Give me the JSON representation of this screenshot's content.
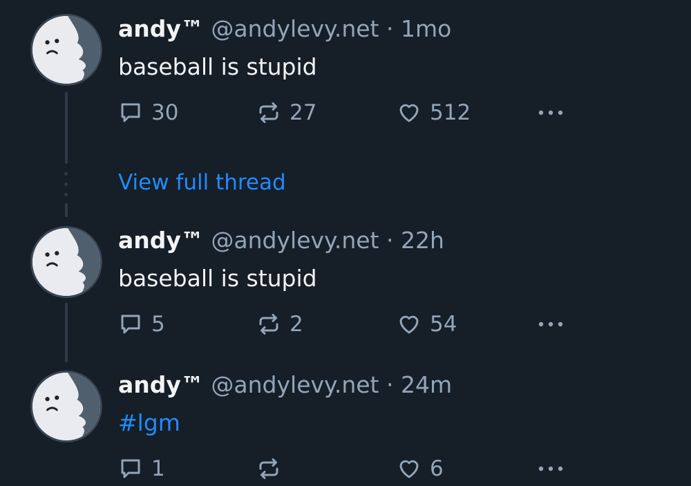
{
  "posts": [
    {
      "display_name": "andy™",
      "handle": "@andylevy.net",
      "separator": "·",
      "time": "1mo",
      "text": "baseball is stupid",
      "replies": "30",
      "reposts": "27",
      "likes": "512"
    },
    {
      "display_name": "andy™",
      "handle": "@andylevy.net",
      "separator": "·",
      "time": "22h",
      "text": "baseball is stupid",
      "replies": "5",
      "reposts": "2",
      "likes": "54"
    },
    {
      "display_name": "andy™",
      "handle": "@andylevy.net",
      "separator": "·",
      "time": "24m",
      "text": "#lgm",
      "replies": "1",
      "reposts": "",
      "likes": "6"
    }
  ],
  "view_full_thread": "View full thread",
  "colors": {
    "background": "#161e27",
    "text_primary": "#f1f3f5",
    "text_secondary": "#93a5b7",
    "link": "#208bfe",
    "thread_line": "#2e3a47"
  },
  "icons": {
    "reply": "speech-bubble-icon",
    "repost": "repost-arrows-icon",
    "like": "heart-icon",
    "more": "ellipsis-icon",
    "avatar": "ghost-avatar"
  }
}
